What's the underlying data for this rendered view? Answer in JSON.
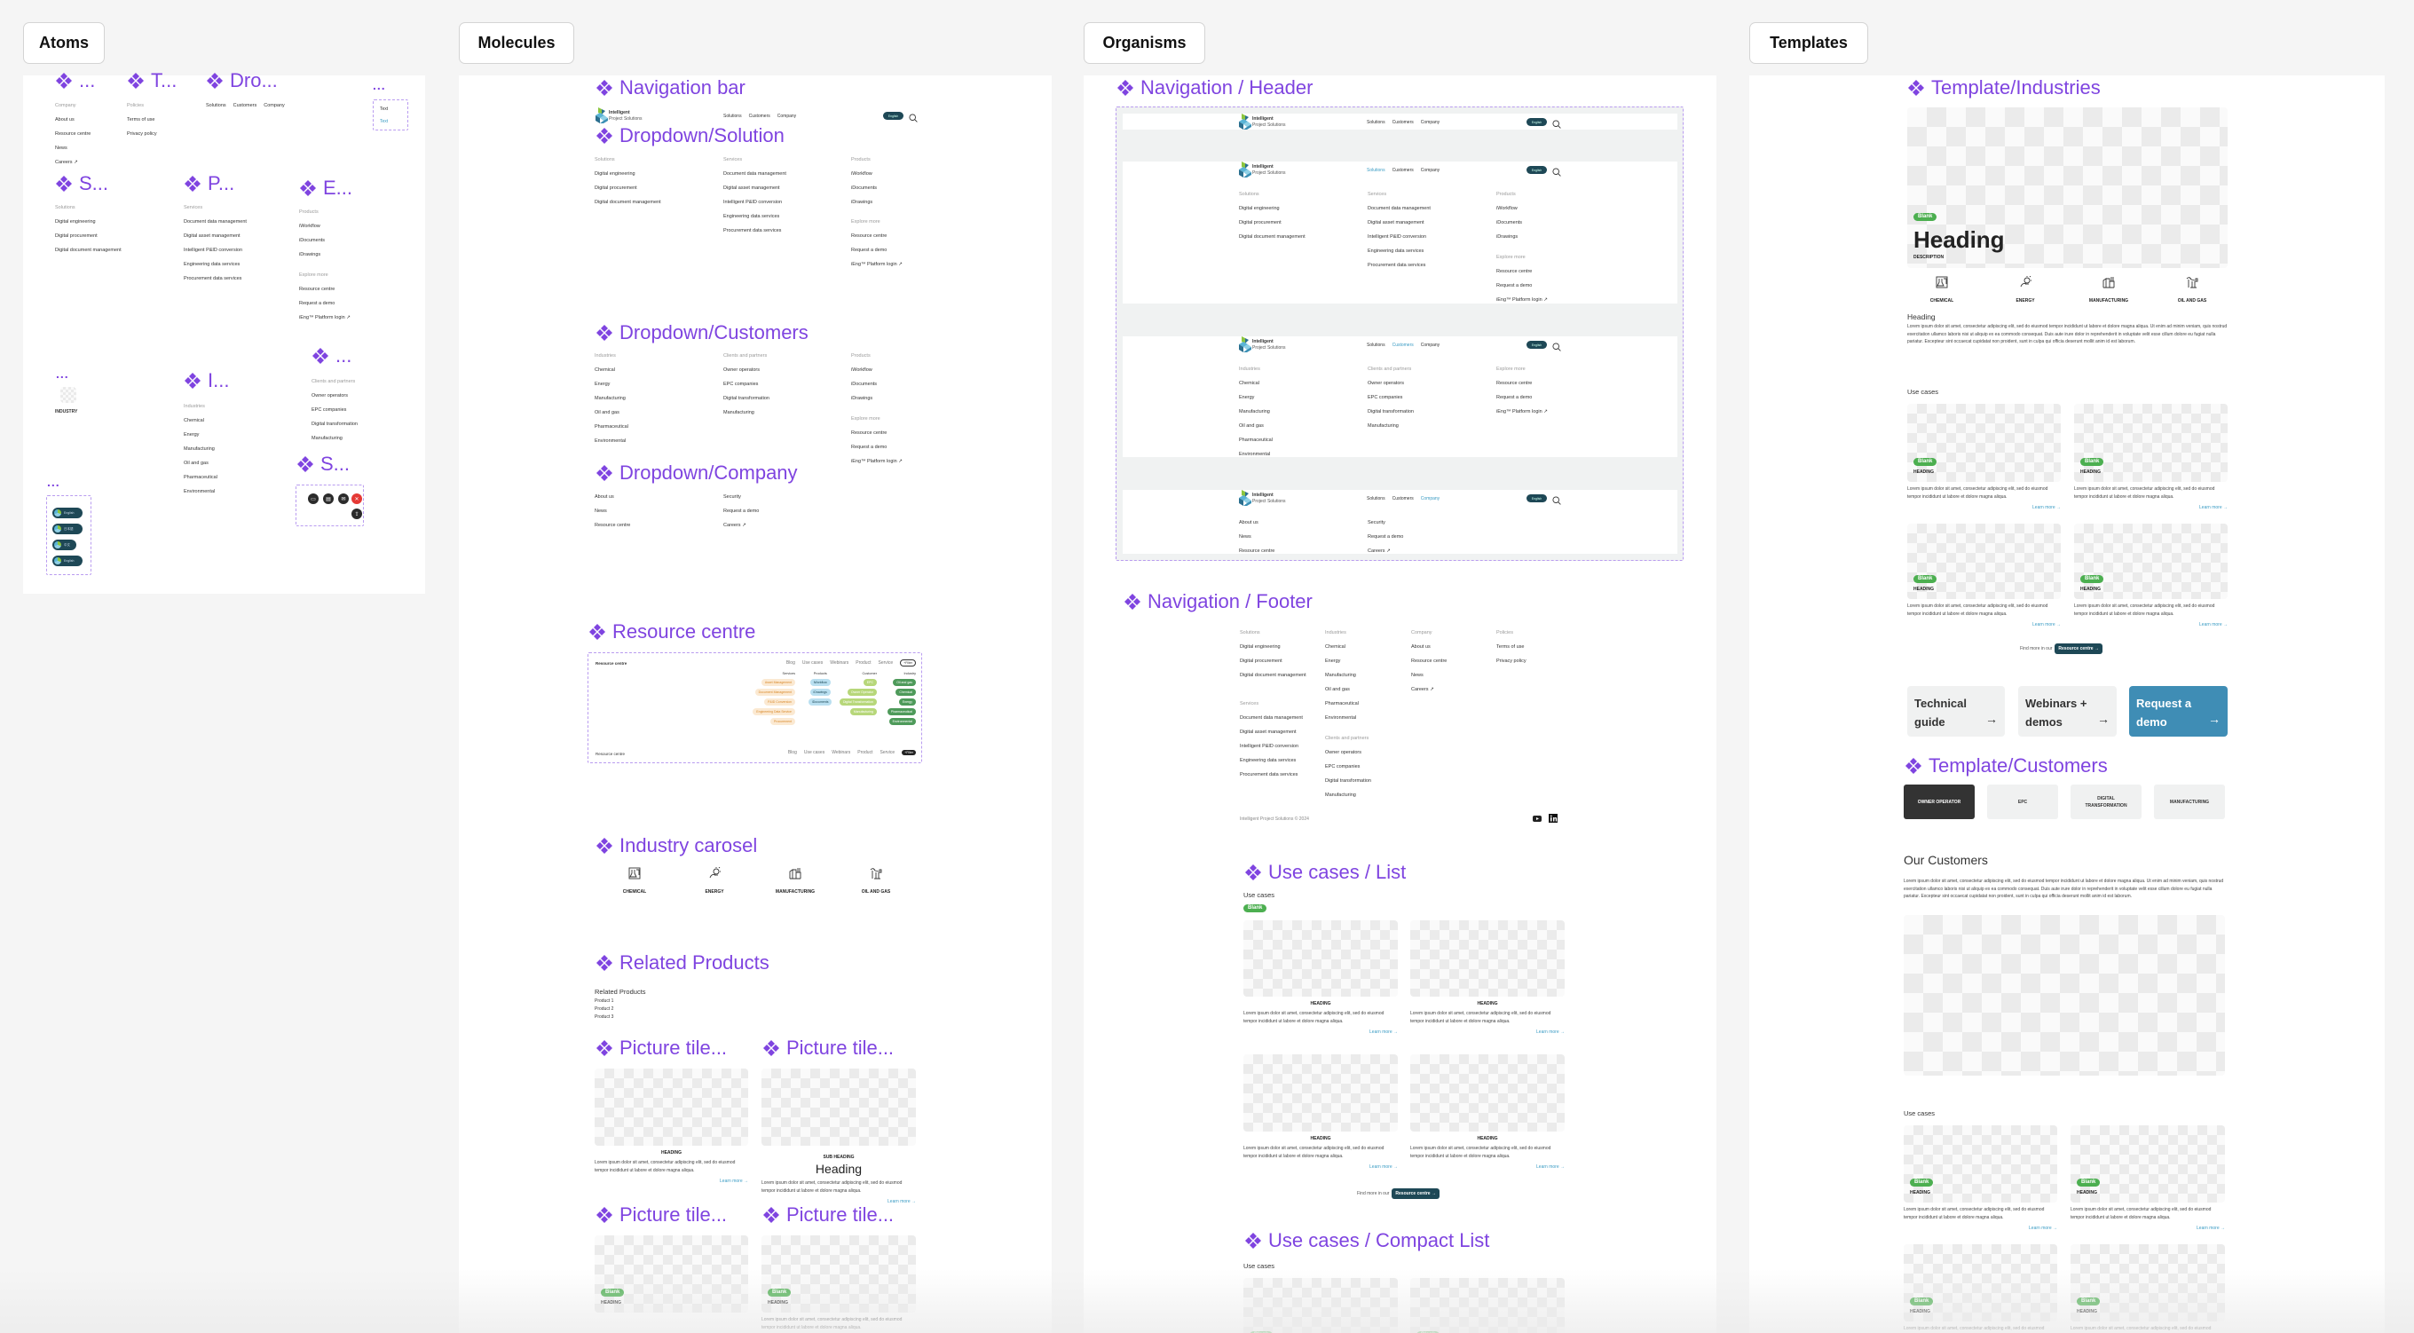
{
  "sections": {
    "atoms": "Atoms",
    "molecules": "Molecules",
    "organisms": "Organisms",
    "templates": "Templates"
  },
  "colors": {
    "component": "#7f44e0",
    "brand_dark": "#1e4856",
    "link": "#3b9cc4",
    "badge": "#4caf50",
    "request_demo": "#3f8db5",
    "active_tab": "#333333"
  },
  "atoms": {
    "titles": [
      "...",
      "T...",
      "Dro...",
      "...",
      "S...",
      "P...",
      "E...",
      "...",
      "I...",
      "...",
      "S...",
      "..."
    ],
    "text_box": [
      "Text",
      "Text"
    ],
    "industry_label": "INDUSTRY",
    "languages": [
      "English",
      "日本語",
      "中文",
      "English"
    ],
    "social_icons": [
      "print-icon",
      "pdf-icon",
      "mail-icon",
      "close-icon",
      "share-icon"
    ]
  },
  "header": {
    "logo_line1": "Intelligent",
    "logo_line2": "Project Solutions",
    "nav": [
      "Solutions",
      "Customers",
      "Company"
    ],
    "language": "English"
  },
  "lists": {
    "footer_company": [
      "Company",
      "About us",
      "Resource centre",
      "News",
      "Careers ↗"
    ],
    "footer_policies": [
      "Policies",
      "Terms of use",
      "Privacy policy"
    ],
    "solutions": [
      "Solutions",
      "Digital engineering",
      "Digital procurement",
      "Digital document management"
    ],
    "services": [
      "Services",
      "Document data management",
      "Digital asset management",
      "Intelligent P&ID conversion",
      "Engineering data services",
      "Procurement data services"
    ],
    "products": [
      "Products",
      "iWorkflow",
      "iDocuments",
      "iDrawings"
    ],
    "explore": [
      "Explore more",
      "Resource centre",
      "Request a demo",
      "iEng™ Platform login ↗"
    ],
    "industries": [
      "Industries",
      "Chemical",
      "Energy",
      "Manufacturing",
      "Oil and gas",
      "Pharmaceutical",
      "Environmental"
    ],
    "clients": [
      "Clients and partners",
      "Owner operators",
      "EPC companies",
      "Digital transformation",
      "Manufacturing"
    ],
    "company_a": [
      "About us",
      "News",
      "Resource centre"
    ],
    "company_b": [
      "Security",
      "Request a demo",
      "Careers ↗"
    ]
  },
  "molecules": {
    "titles": {
      "nav_bar": "Navigation bar",
      "dd_solution": "Dropdown/Solution",
      "dd_customers": "Dropdown/Customers",
      "dd_company": "Dropdown/Company",
      "resource": "Resource centre",
      "industry": "Industry carosel",
      "related": "Related Products",
      "picture_tile": "Picture tile..."
    },
    "resource_centre": {
      "title": "Resource centre",
      "tabs": [
        "Blog",
        "Use cases",
        "Webinars",
        "Product",
        "Service"
      ],
      "filter": "+Filter",
      "groups": [
        {
          "name": "Services",
          "color": "#fbe9d2",
          "text": "#d98a2b",
          "items": [
            "Asset Management",
            "Document Management",
            "P&ID Conversion",
            "Engineering Data Service",
            "Procurement"
          ]
        },
        {
          "name": "Products",
          "color": "#b9dff0",
          "text": "#1e4856",
          "items": [
            "iWorkflow",
            "iDrawings",
            "iDocuments"
          ]
        },
        {
          "name": "Customer",
          "color": "#b7d77a",
          "text": "#ffffff",
          "items": [
            "EPC",
            "Owner Operator",
            "Digital Transformation",
            "Manufacturing"
          ]
        },
        {
          "name": "Industry",
          "color": "#4e9a5a",
          "text": "#ffffff",
          "items": [
            "Oil and gas",
            "Chemical",
            "Energy",
            "Pharmaceutical",
            "Environmental"
          ]
        }
      ]
    },
    "industries": [
      "CHEMICAL",
      "ENERGY",
      "MANUFACTURING",
      "OIL AND GAS"
    ],
    "related": {
      "heading": "Related Products",
      "items": [
        "Product 1",
        "Product 2",
        "Product 3"
      ]
    }
  },
  "tile": {
    "heading": "HEADING",
    "sub_heading": "SUB HEADING",
    "big_heading": "Heading",
    "lorem": "Lorem ipsum dolor sit amet, consectetur adipiscing elit, sed do eiusmod tempor incididunt ut labore et dolore magna aliqua.",
    "learn_more": "Learn more →",
    "badge": "Blank"
  },
  "organisms": {
    "titles": {
      "header": "Navigation / Header",
      "footer": "Navigation / Footer",
      "use_list": "Use cases / List",
      "use_compact": "Use cases / Compact List"
    },
    "copyright": "Intelligent Project Solutions © 2024",
    "use_cases_label": "Use cases",
    "find_more": "Find more in our",
    "resource_button": "Resource centre →"
  },
  "templates": {
    "titles": {
      "industries": "Template/Industries",
      "customers": "Template/Customers"
    },
    "hero_heading": "Heading",
    "hero_description": "DESCRIPTION",
    "body_heading": "Heading",
    "long_lorem": "Lorem ipsum dolor sit amet, consectetur adipiscing elit, sed do eiusmod tempor incididunt ut labore et dolore magna aliqua. Ut enim ad minim veniam, quis nostrud exercitation ullamco laboris nisi ut aliquip ex ea commodo consequat. Duis aute irure dolor in reprehenderit in voluptate velit esse cillum dolore eu fugiat nulla pariatur. Excepteur sint occaecat cupidatat non proident, sunt in culpa qui officia deserunt mollit anim id est laborum.",
    "use_cases": "Use cases",
    "cards": [
      "Technical guide",
      "Webinars + demos",
      "Request a demo"
    ],
    "tabs": [
      "OWNER OPERATOR",
      "EPC",
      "DIGITAL TRANSFORMATION",
      "MANUFACTURING"
    ],
    "active_tab": "OWNER OPERATOR",
    "our_customers": "Our Customers"
  }
}
